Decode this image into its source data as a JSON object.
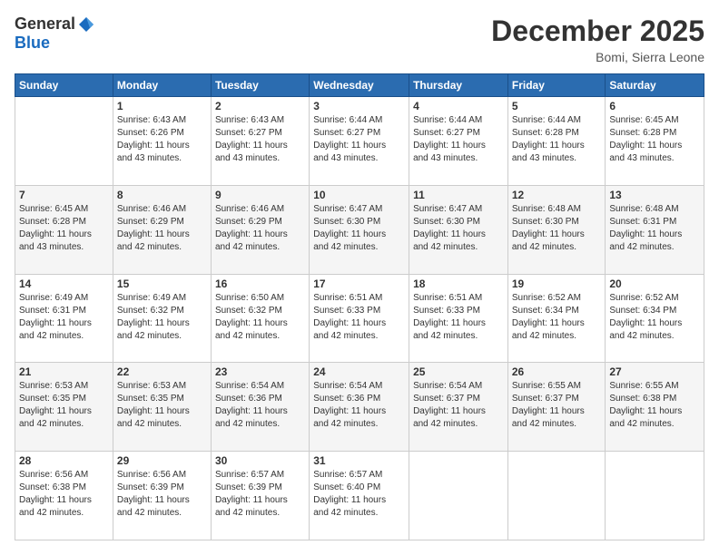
{
  "logo": {
    "general": "General",
    "blue": "Blue"
  },
  "title": "December 2025",
  "location": "Bomi, Sierra Leone",
  "days_header": [
    "Sunday",
    "Monday",
    "Tuesday",
    "Wednesday",
    "Thursday",
    "Friday",
    "Saturday"
  ],
  "weeks": [
    [
      {
        "day": "",
        "info": ""
      },
      {
        "day": "1",
        "info": "Sunrise: 6:43 AM\nSunset: 6:26 PM\nDaylight: 11 hours\nand 43 minutes."
      },
      {
        "day": "2",
        "info": "Sunrise: 6:43 AM\nSunset: 6:27 PM\nDaylight: 11 hours\nand 43 minutes."
      },
      {
        "day": "3",
        "info": "Sunrise: 6:44 AM\nSunset: 6:27 PM\nDaylight: 11 hours\nand 43 minutes."
      },
      {
        "day": "4",
        "info": "Sunrise: 6:44 AM\nSunset: 6:27 PM\nDaylight: 11 hours\nand 43 minutes."
      },
      {
        "day": "5",
        "info": "Sunrise: 6:44 AM\nSunset: 6:28 PM\nDaylight: 11 hours\nand 43 minutes."
      },
      {
        "day": "6",
        "info": "Sunrise: 6:45 AM\nSunset: 6:28 PM\nDaylight: 11 hours\nand 43 minutes."
      }
    ],
    [
      {
        "day": "7",
        "info": "Sunrise: 6:45 AM\nSunset: 6:28 PM\nDaylight: 11 hours\nand 43 minutes."
      },
      {
        "day": "8",
        "info": "Sunrise: 6:46 AM\nSunset: 6:29 PM\nDaylight: 11 hours\nand 42 minutes."
      },
      {
        "day": "9",
        "info": "Sunrise: 6:46 AM\nSunset: 6:29 PM\nDaylight: 11 hours\nand 42 minutes."
      },
      {
        "day": "10",
        "info": "Sunrise: 6:47 AM\nSunset: 6:30 PM\nDaylight: 11 hours\nand 42 minutes."
      },
      {
        "day": "11",
        "info": "Sunrise: 6:47 AM\nSunset: 6:30 PM\nDaylight: 11 hours\nand 42 minutes."
      },
      {
        "day": "12",
        "info": "Sunrise: 6:48 AM\nSunset: 6:30 PM\nDaylight: 11 hours\nand 42 minutes."
      },
      {
        "day": "13",
        "info": "Sunrise: 6:48 AM\nSunset: 6:31 PM\nDaylight: 11 hours\nand 42 minutes."
      }
    ],
    [
      {
        "day": "14",
        "info": "Sunrise: 6:49 AM\nSunset: 6:31 PM\nDaylight: 11 hours\nand 42 minutes."
      },
      {
        "day": "15",
        "info": "Sunrise: 6:49 AM\nSunset: 6:32 PM\nDaylight: 11 hours\nand 42 minutes."
      },
      {
        "day": "16",
        "info": "Sunrise: 6:50 AM\nSunset: 6:32 PM\nDaylight: 11 hours\nand 42 minutes."
      },
      {
        "day": "17",
        "info": "Sunrise: 6:51 AM\nSunset: 6:33 PM\nDaylight: 11 hours\nand 42 minutes."
      },
      {
        "day": "18",
        "info": "Sunrise: 6:51 AM\nSunset: 6:33 PM\nDaylight: 11 hours\nand 42 minutes."
      },
      {
        "day": "19",
        "info": "Sunrise: 6:52 AM\nSunset: 6:34 PM\nDaylight: 11 hours\nand 42 minutes."
      },
      {
        "day": "20",
        "info": "Sunrise: 6:52 AM\nSunset: 6:34 PM\nDaylight: 11 hours\nand 42 minutes."
      }
    ],
    [
      {
        "day": "21",
        "info": "Sunrise: 6:53 AM\nSunset: 6:35 PM\nDaylight: 11 hours\nand 42 minutes."
      },
      {
        "day": "22",
        "info": "Sunrise: 6:53 AM\nSunset: 6:35 PM\nDaylight: 11 hours\nand 42 minutes."
      },
      {
        "day": "23",
        "info": "Sunrise: 6:54 AM\nSunset: 6:36 PM\nDaylight: 11 hours\nand 42 minutes."
      },
      {
        "day": "24",
        "info": "Sunrise: 6:54 AM\nSunset: 6:36 PM\nDaylight: 11 hours\nand 42 minutes."
      },
      {
        "day": "25",
        "info": "Sunrise: 6:54 AM\nSunset: 6:37 PM\nDaylight: 11 hours\nand 42 minutes."
      },
      {
        "day": "26",
        "info": "Sunrise: 6:55 AM\nSunset: 6:37 PM\nDaylight: 11 hours\nand 42 minutes."
      },
      {
        "day": "27",
        "info": "Sunrise: 6:55 AM\nSunset: 6:38 PM\nDaylight: 11 hours\nand 42 minutes."
      }
    ],
    [
      {
        "day": "28",
        "info": "Sunrise: 6:56 AM\nSunset: 6:38 PM\nDaylight: 11 hours\nand 42 minutes."
      },
      {
        "day": "29",
        "info": "Sunrise: 6:56 AM\nSunset: 6:39 PM\nDaylight: 11 hours\nand 42 minutes."
      },
      {
        "day": "30",
        "info": "Sunrise: 6:57 AM\nSunset: 6:39 PM\nDaylight: 11 hours\nand 42 minutes."
      },
      {
        "day": "31",
        "info": "Sunrise: 6:57 AM\nSunset: 6:40 PM\nDaylight: 11 hours\nand 42 minutes."
      },
      {
        "day": "",
        "info": ""
      },
      {
        "day": "",
        "info": ""
      },
      {
        "day": "",
        "info": ""
      }
    ]
  ]
}
